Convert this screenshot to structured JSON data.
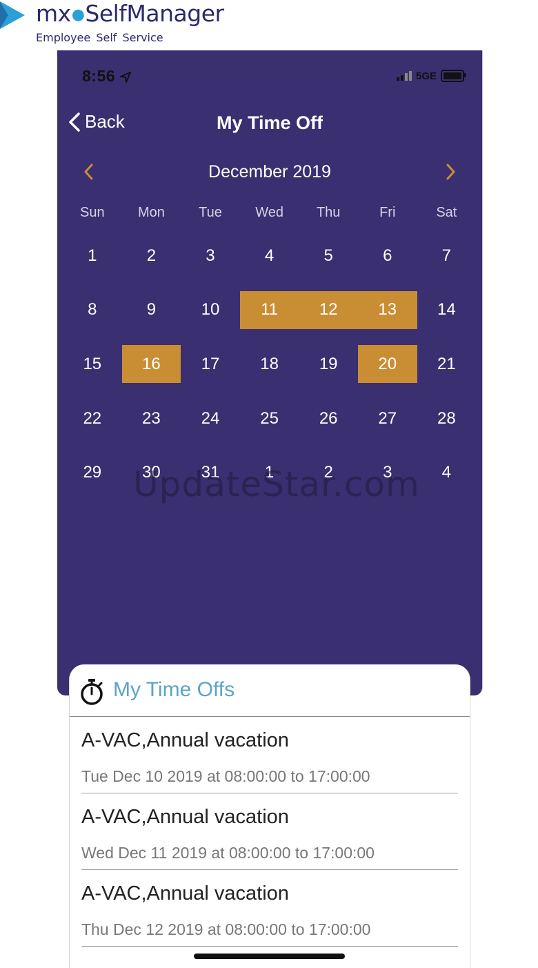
{
  "logo": {
    "brand_mx": "mx",
    "brand_name": "SelfManager",
    "subtitle": "Employee  Self Service"
  },
  "status_bar": {
    "time": "8:56",
    "network": "5GE"
  },
  "nav": {
    "back_label": "Back",
    "title": "My Time Off"
  },
  "calendar": {
    "month_label": "December 2019",
    "weekdays": [
      "Sun",
      "Mon",
      "Tue",
      "Wed",
      "Thu",
      "Fri",
      "Sat"
    ],
    "weeks": [
      [
        "1",
        "2",
        "3",
        "4",
        "5",
        "6",
        "7"
      ],
      [
        "8",
        "9",
        "10",
        "11",
        "12",
        "13",
        "14"
      ],
      [
        "15",
        "16",
        "17",
        "18",
        "19",
        "20",
        "21"
      ],
      [
        "22",
        "23",
        "24",
        "25",
        "26",
        "27",
        "28"
      ],
      [
        "29",
        "30",
        "31",
        "1",
        "2",
        "3",
        "4"
      ]
    ],
    "selected_days": [
      "11",
      "12",
      "13",
      "16",
      "20"
    ],
    "accent_color": "#c98d34",
    "background_color": "#3a2f70"
  },
  "watermark": "UpdateStar.com",
  "time_offs": {
    "title": "My Time Offs",
    "items": [
      {
        "title": "A-VAC,Annual vacation",
        "detail": "Tue Dec 10 2019 at 08:00:00 to 17:00:00"
      },
      {
        "title": "A-VAC,Annual vacation",
        "detail": "Wed Dec 11 2019 at 08:00:00 to 17:00:00"
      },
      {
        "title": "A-VAC,Annual vacation",
        "detail": "Thu Dec 12 2019 at 08:00:00 to 17:00:00"
      }
    ]
  }
}
